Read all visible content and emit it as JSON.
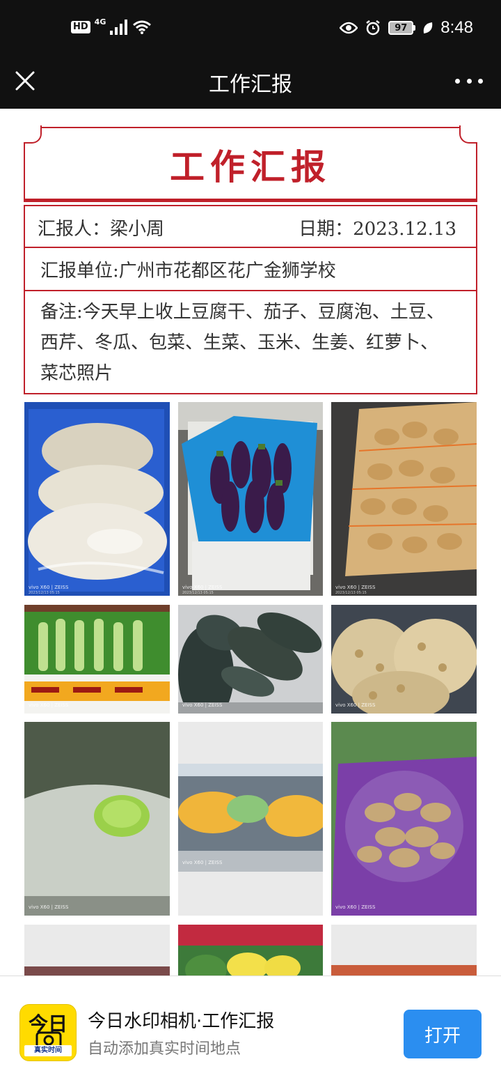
{
  "status_bar": {
    "hd": "HD",
    "network": "4G",
    "battery": "97",
    "time": "8:48"
  },
  "nav": {
    "title": "工作汇报"
  },
  "report": {
    "title": "工作汇报",
    "reporter": "汇报人：梁小周",
    "date": "日期：2023.12.13",
    "unit": "汇报单位:广州市花都区花广金狮学校",
    "note": "备注:今天早上收上豆腐干、茄子、豆腐泡、土豆、西芹、冬瓜、包菜、生菜、玉米、生姜、红萝卜、菜芯照片"
  },
  "photos": {
    "watermark": "vivo X60 | ZEISS",
    "watermark_date": "2023/12/13 05:15",
    "items": [
      {
        "name": "tofu-dry"
      },
      {
        "name": "eggplant"
      },
      {
        "name": "potato"
      },
      {
        "name": "celery"
      },
      {
        "name": "winter-melon"
      },
      {
        "name": "tofu-puff"
      },
      {
        "name": "cabbage"
      },
      {
        "name": "lettuce"
      },
      {
        "name": "ginger"
      },
      {
        "name": "partial-1"
      },
      {
        "name": "corn"
      },
      {
        "name": "partial-3"
      }
    ]
  },
  "banner": {
    "app_name": "今日水印相机·工作汇报",
    "app_desc": "自动添加真实时间地点",
    "icon_text": "今日",
    "icon_strip": "真实时间",
    "open_label": "打开"
  },
  "colors": {
    "accent_red": "#c0202a",
    "button_blue": "#2b8ef0",
    "icon_yellow": "#ffdb00"
  }
}
